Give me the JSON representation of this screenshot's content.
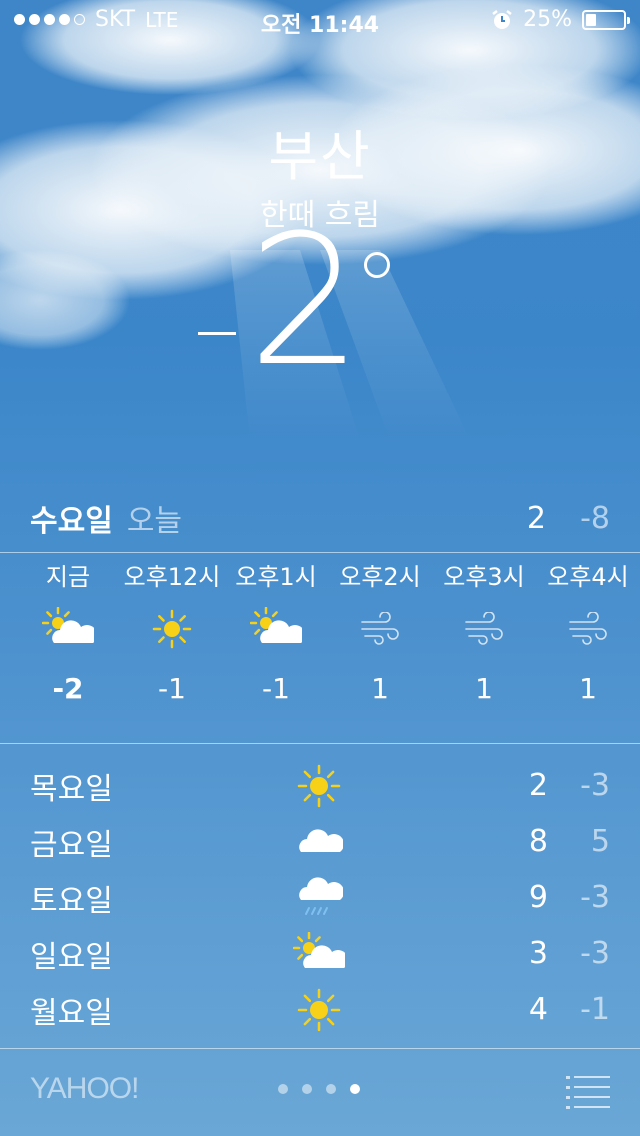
{
  "status_bar": {
    "carrier": "SKT",
    "network": "LTE",
    "time": "오전 11:44",
    "battery": "25%",
    "signal_bars_filled": 4,
    "signal_bars_total": 5
  },
  "location": {
    "city": "부산",
    "condition": "한때 흐림",
    "temperature": "-2",
    "degree_icon": "degree-symbol"
  },
  "today": {
    "day": "수요일",
    "label": "오늘",
    "high": "2",
    "low": "-8"
  },
  "hourly": [
    {
      "time": "지금",
      "icon": "partly-cloudy-icon",
      "temp": "-2"
    },
    {
      "time": "오후12시",
      "icon": "sun-icon",
      "temp": "-1"
    },
    {
      "time": "오후1시",
      "icon": "partly-cloudy-icon",
      "temp": "-1"
    },
    {
      "time": "오후2시",
      "icon": "wind-icon",
      "temp": "1"
    },
    {
      "time": "오후3시",
      "icon": "wind-icon",
      "temp": "1"
    },
    {
      "time": "오후4시",
      "icon": "wind-icon",
      "temp": "1"
    }
  ],
  "daily": [
    {
      "day": "목요일",
      "icon": "sun-icon",
      "high": "2",
      "low": "-3"
    },
    {
      "day": "금요일",
      "icon": "cloud-icon",
      "high": "8",
      "low": "5"
    },
    {
      "day": "토요일",
      "icon": "rain-cloud-icon",
      "high": "9",
      "low": "-3"
    },
    {
      "day": "일요일",
      "icon": "partly-cloudy-icon",
      "high": "3",
      "low": "-3"
    },
    {
      "day": "월요일",
      "icon": "sun-icon",
      "high": "4",
      "low": "-1"
    }
  ],
  "footer": {
    "provider": "YAHOO!",
    "pages": 4,
    "active_page": 4
  },
  "colors": {
    "sky_top": "#3f86c8",
    "sky_bottom": "#6aa7d6",
    "sun": "#f7d117",
    "text": "#ffffff"
  }
}
